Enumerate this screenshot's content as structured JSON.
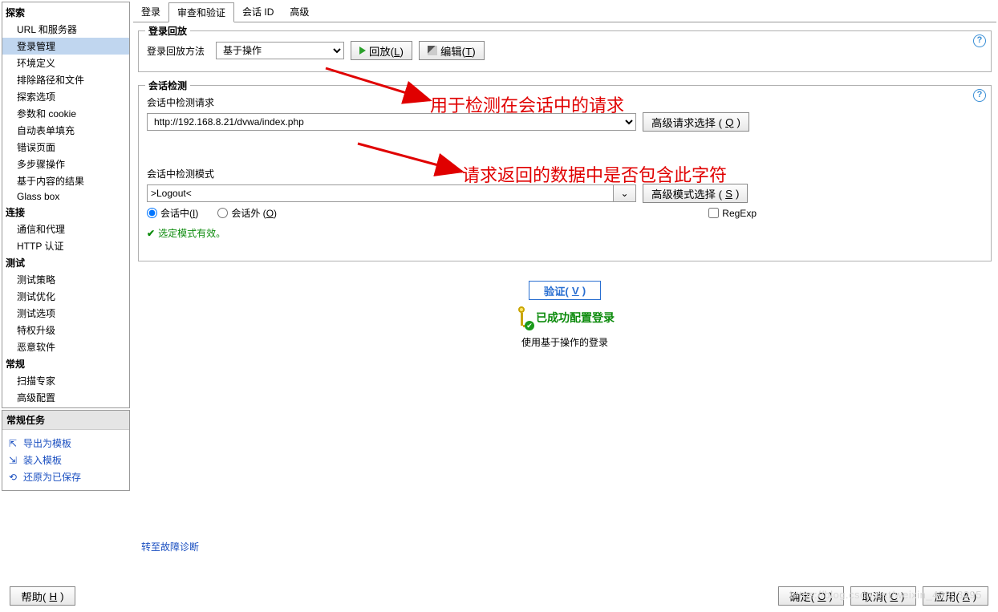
{
  "sidebar": {
    "sections": [
      {
        "title": "探索",
        "items": [
          "URL 和服务器",
          "登录管理",
          "环境定义",
          "排除路径和文件",
          "探索选项",
          "参数和 cookie",
          "自动表单填充",
          "错误页面",
          "多步骤操作",
          "基于内容的结果",
          "Glass box"
        ],
        "selectedIndex": 1
      },
      {
        "title": "连接",
        "items": [
          "通信和代理",
          "HTTP 认证"
        ]
      },
      {
        "title": "测试",
        "items": [
          "测试策略",
          "测试优化",
          "测试选项",
          "特权升级",
          "恶意软件"
        ]
      },
      {
        "title": "常规",
        "items": [
          "扫描专家",
          "高级配置"
        ]
      }
    ]
  },
  "tasks": {
    "header": "常规任务",
    "items": [
      "导出为模板",
      "装入模板",
      "还原为已保存"
    ]
  },
  "tabs": {
    "items": [
      "登录",
      "审查和验证",
      "会话 ID",
      "高级"
    ],
    "activeIndex": 1
  },
  "group_replay": {
    "title": "登录回放",
    "method_label": "登录回放方法",
    "method_value": "基于操作",
    "replay_btn": "回放(L)",
    "edit_btn": "编辑(T)"
  },
  "group_session": {
    "title": "会话检测",
    "req_label": "会话中检测请求",
    "req_value": "http://192.168.8.21/dvwa/index.php",
    "adv_req_btn": "高级请求选择 (Q)",
    "pattern_label": "会话中检测模式",
    "pattern_value": ">Logout<",
    "adv_pattern_btn": "高级模式选择 (S)",
    "radio_in": "会话中(I)",
    "radio_out": "会话外 (O)",
    "regexp": "RegExp",
    "valid_msg": "选定模式有效。"
  },
  "verify": {
    "btn": "验证(V)",
    "success": "已成功配置登录",
    "sub": "使用基于操作的登录"
  },
  "diag_link": "转至故障诊断",
  "footer": {
    "help": "帮助(H)",
    "ok": "确定(O)",
    "cancel": "取消(C)",
    "apply": "应用(A)"
  },
  "annotations": {
    "a1": "用于检测在会话中的请求",
    "a2": "请求返回的数据中是否包含此字符"
  },
  "watermark": "https://blog.csdn.net/weixin_43303095"
}
